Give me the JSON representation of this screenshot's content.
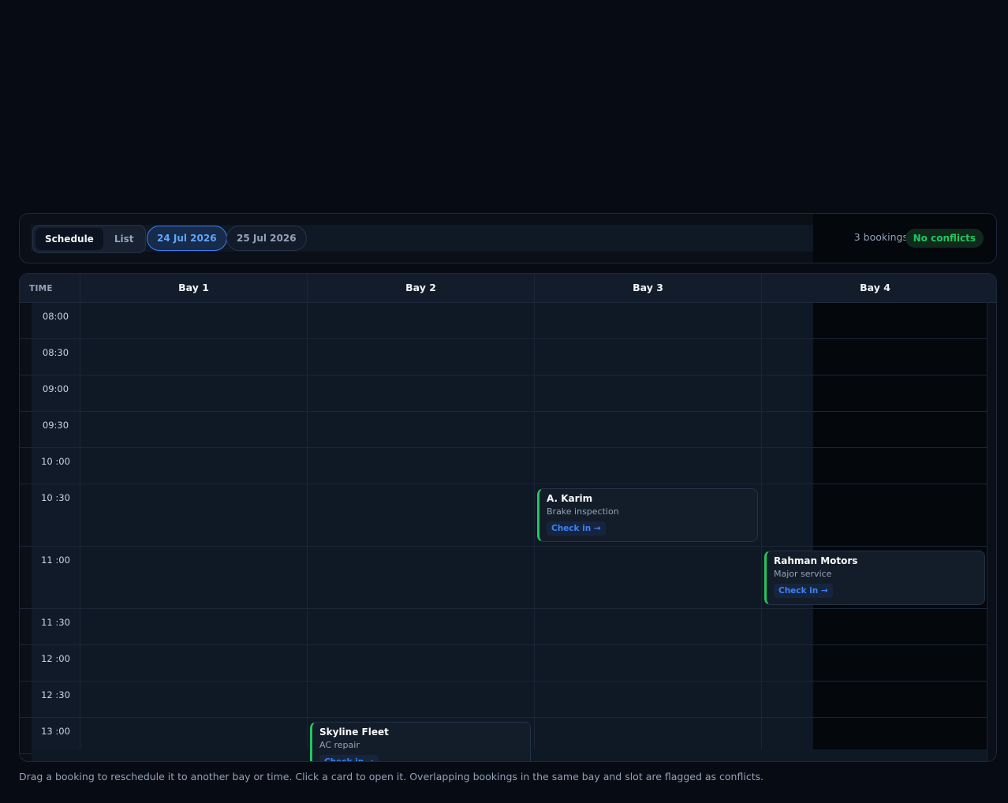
{
  "toolbar": {
    "views": [
      {
        "label": "Schedule",
        "active": true
      },
      {
        "label": "List",
        "active": false
      }
    ],
    "dates": [
      {
        "label": "24 Jul 2026",
        "active": true
      },
      {
        "label": "25 Jul 2026",
        "active": false
      }
    ],
    "booking_count": "3 bookings",
    "conflict_status": "No conflicts"
  },
  "board": {
    "time_header": "TIME",
    "bays": [
      "Bay 1",
      "Bay 2",
      "Bay 3",
      "Bay 4"
    ],
    "times": [
      "08:00",
      "08:30",
      "09:00",
      "09:30",
      "10 :00",
      "10 :30",
      "11 :00",
      "11 :30",
      "12 :00",
      "12 :30",
      "13 :00"
    ]
  },
  "bookings": [
    {
      "customer": "A. Karim",
      "service": "Brake inspection",
      "action": "Check in →",
      "bay": "Bay 3",
      "time": "10 :30"
    },
    {
      "customer": "Rahman Motors",
      "service": "Major service",
      "action": "Check in →",
      "bay": "Bay 4",
      "time": "11 :00"
    },
    {
      "customer": "Skyline Fleet",
      "service": "AC repair",
      "action": "Check in →",
      "bay": "Bay 2",
      "time": "13 :00"
    }
  ],
  "colors": {
    "accent": "#3b82f6",
    "success": "#22c55e",
    "background": "#070b13"
  },
  "footnote": "Drag a booking to reschedule it to another bay or time. Click a card to open it. Overlapping bookings in the same bay and slot are flagged as conflicts."
}
